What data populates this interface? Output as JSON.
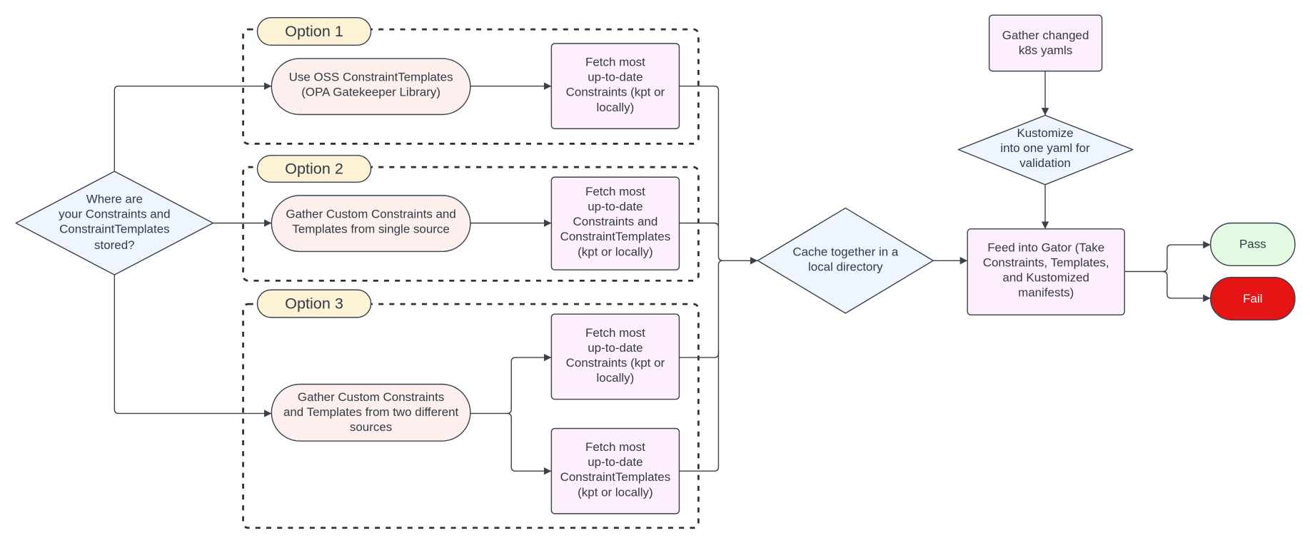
{
  "colors": {
    "option_pill": "#fdf1d6",
    "oval": "#fdefee",
    "process_box": "#fdf0fc",
    "decision": "#eef5ff",
    "pass": "#e2fbe2",
    "fail": "#e51515",
    "stroke": "#3a414a"
  },
  "options": [
    {
      "label": "Option 1"
    },
    {
      "label": "Option 2"
    },
    {
      "label": "Option 3"
    }
  ],
  "nodes": {
    "start_decision": [
      "Where are",
      "your Constraints and",
      "ConstraintTemplates",
      "stored?"
    ],
    "oval1": [
      "Use OSS ConstraintTemplates",
      "(OPA Gatekeeper Library)"
    ],
    "oval2": [
      "Gather Custom Constraints and",
      "Templates from single source"
    ],
    "oval3": [
      "Gather Custom Constraints",
      "and Templates from two different",
      "sources"
    ],
    "fetch1": [
      "Fetch most",
      "up-to-date",
      "Constraints (kpt or",
      "locally)"
    ],
    "fetch2": [
      "Fetch most",
      "up-to-date",
      "Constraints and",
      "ConstraintTemplates",
      "(kpt or locally)"
    ],
    "fetch3a": [
      "Fetch most",
      "up-to-date",
      "Constraints (kpt or",
      "locally)"
    ],
    "fetch3b": [
      "Fetch most",
      "up-to-date",
      "ConstraintTemplates",
      "(kpt or locally)"
    ],
    "cache": [
      "Cache together in a",
      "local directory"
    ],
    "gather_yamls": [
      "Gather changed",
      "k8s yamls"
    ],
    "kustomize": [
      "Kustomize",
      "into one yaml for",
      "validation"
    ],
    "feed": [
      "Feed into Gator (Take",
      "Constraints, Templates,",
      "and Kustomized",
      "manifests)"
    ],
    "pass": "Pass",
    "fail": "Fail"
  }
}
